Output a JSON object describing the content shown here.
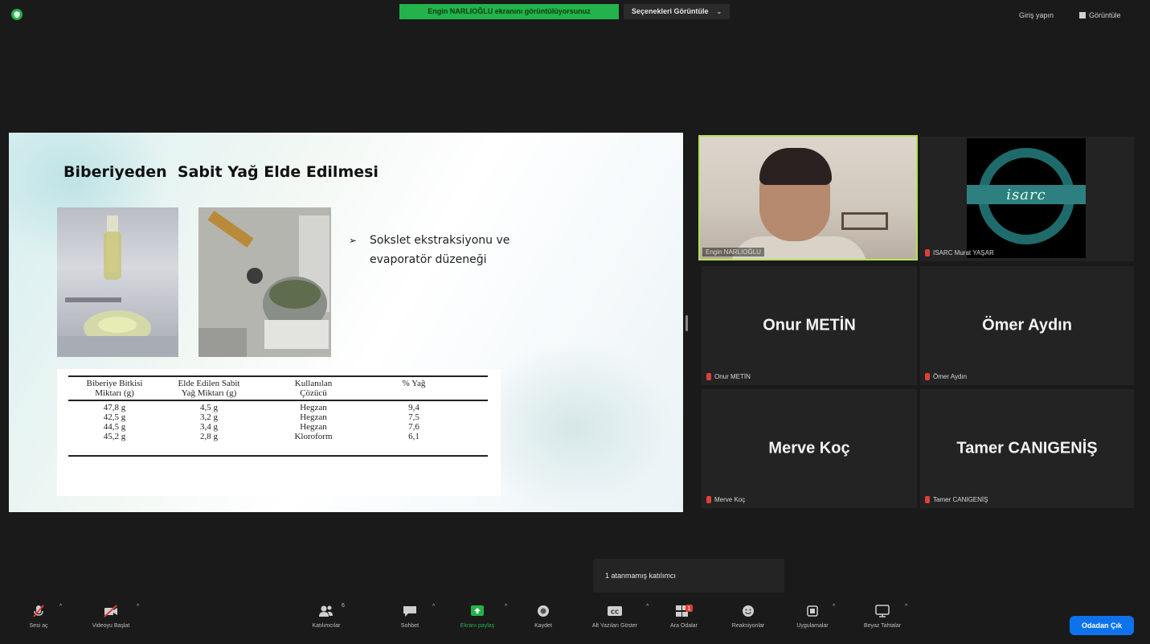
{
  "topbar": {
    "share_banner": "Engin NARLIOĞLU ekranını görüntülüyorsunuz",
    "view_options": "Seçenekleri Görüntüle",
    "view_options_caret": "⌄",
    "sign_in": "Giriş yapın",
    "view": "Görüntüle"
  },
  "slide": {
    "title": "Biberiyeden  Sabit Yağ Elde Edilmesi",
    "bullet_marker": "➢",
    "bullet_line1": "Sokslet ekstraksiyonu ve",
    "bullet_line2": "evaporatör düzeneği",
    "table": {
      "headers_line1": [
        "Biberiye Bitkisi",
        "Elde Edilen Sabit",
        "Kullanılan",
        "% Yağ"
      ],
      "headers_line2": [
        "Miktarı (g)",
        "Yağ Miktarı (g)",
        "Çözücü",
        ""
      ],
      "rows": [
        [
          "47,8 g",
          "4,5 g",
          "Hegzan",
          "9,4"
        ],
        [
          "42,5 g",
          "3,2 g",
          "Hegzan",
          "7,5"
        ],
        [
          "44,5 g",
          "3,4 g",
          "Hegzan",
          "7,6"
        ],
        [
          "45,2 g",
          "2,8 g",
          "Kloroform",
          "6,1"
        ]
      ]
    }
  },
  "participants": {
    "video_label": "Engin NARLIOĞLU",
    "isarc_logo_text": "isarc",
    "isarc_label": "ISARC Murat YAŞAR",
    "onur": {
      "big": "Onur METİN",
      "small": "Onur METİN"
    },
    "omer": {
      "big": "Ömer Aydın",
      "small": "Ömer Aydın"
    },
    "merve": {
      "big": "Merve Koç",
      "small": "Merve Koç"
    },
    "tamer": {
      "big": "Tamer CANIGENİŞ",
      "small": "Tamer CANIGENİŞ"
    }
  },
  "tooltip": "1 atanmamış katılımcı",
  "toolbar": {
    "caret": "^",
    "unmute": "Sesi aç",
    "start_video": "Videoyu Başlat",
    "participants": "Katılımcılar",
    "participants_count": "6",
    "chat": "Sohbet",
    "share_screen": "Ekranı paylaş",
    "record": "Kaydet",
    "captions": "Alt Yazıları Göster",
    "breakout": "Ara Odalar",
    "breakout_badge": "1",
    "reactions": "Reaksiyonlar",
    "apps": "Uygulamalar",
    "whiteboard": "Beyaz Tahtalar",
    "leave_rooms": "Odadan Çık"
  },
  "colors": {
    "accent_green": "#23b24b",
    "leave_blue": "#0e72ed",
    "active_speaker": "#b6e05a",
    "muted_red": "#e0403a"
  }
}
